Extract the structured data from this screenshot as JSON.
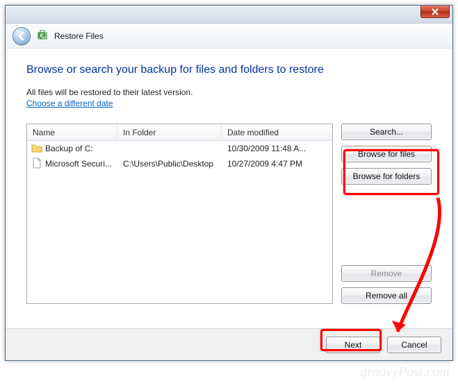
{
  "window": {
    "title": "Restore Files"
  },
  "heading": "Browse or search your backup for files and folders to restore",
  "subtext": "All files will be restored to their latest version.",
  "link_text": "Choose a different date",
  "columns": {
    "name": "Name",
    "folder": "In Folder",
    "date": "Date modified"
  },
  "rows": [
    {
      "icon": "folder",
      "name": "Backup of C:",
      "folder": "",
      "date": "10/30/2009 11:48 A..."
    },
    {
      "icon": "file",
      "name": "Microsoft Securi...",
      "folder": "C:\\Users\\Public\\Desktop",
      "date": "10/27/2009 4:47 PM"
    }
  ],
  "buttons": {
    "search": "Search...",
    "browse_files": "Browse for files",
    "browse_folders": "Browse for folders",
    "remove": "Remove",
    "remove_all": "Remove all",
    "next": "Next",
    "cancel": "Cancel"
  },
  "watermark": "groovyPost.com"
}
